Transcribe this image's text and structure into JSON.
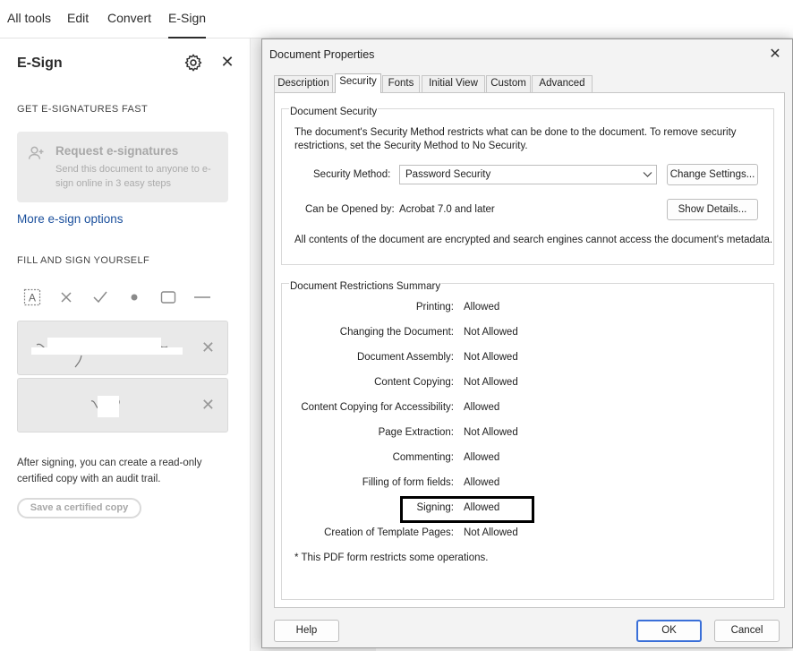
{
  "topnav": {
    "items": [
      "All tools",
      "Edit",
      "Convert",
      "E-Sign"
    ],
    "active_index": 3
  },
  "esign_panel": {
    "title": "E-Sign",
    "icons": [
      "gear-icon",
      "close-icon"
    ],
    "section_fast": "GET E-SIGNATURES FAST",
    "request_title": "Request e-signatures",
    "request_desc": "Send this document to anyone to e-sign online in 3 easy steps",
    "more_link": "More e-sign options",
    "section_self": "FILL AND SIGN YOURSELF",
    "tools": [
      "text-field-icon",
      "cross-mark-icon",
      "checkmark-icon",
      "dot-icon",
      "rectangle-icon",
      "line-icon"
    ],
    "after_text": "After signing, you can create a read-only certified copy with an audit trail.",
    "cert_button": "Save a certified copy"
  },
  "dialog": {
    "title": "Document Properties",
    "tabs": [
      "Description",
      "Security",
      "Fonts",
      "Initial View",
      "Custom",
      "Advanced"
    ],
    "active_tab": 1,
    "security_group": "Document Security",
    "security_intro": "The document's Security Method restricts what can be done to the document. To remove security restrictions, set the Security Method to No Security.",
    "method_label": "Security Method:",
    "method_value": "Password Security",
    "change_settings": "Change Settings...",
    "opened_label": "Can be Opened by:",
    "opened_value": "Acrobat 7.0 and later",
    "show_details": "Show Details...",
    "encrypt_note": "All contents of the document are encrypted and search engines cannot access the document's metadata.",
    "restrictions_group": "Document Restrictions Summary",
    "restrictions": [
      {
        "label": "Printing:",
        "value": "Allowed"
      },
      {
        "label": "Changing the Document:",
        "value": "Not Allowed"
      },
      {
        "label": "Document Assembly:",
        "value": "Not Allowed"
      },
      {
        "label": "Content Copying:",
        "value": "Not Allowed"
      },
      {
        "label": "Content Copying for Accessibility:",
        "value": "Allowed"
      },
      {
        "label": "Page Extraction:",
        "value": "Not Allowed"
      },
      {
        "label": "Commenting:",
        "value": "Allowed"
      },
      {
        "label": "Filling of form fields:",
        "value": "Allowed"
      },
      {
        "label": "Signing:",
        "value": "Allowed"
      },
      {
        "label": "Creation of Template Pages:",
        "value": "Not Allowed"
      }
    ],
    "footnote": "*   This PDF form restricts some operations.",
    "help_button": "Help",
    "ok_button": "OK",
    "cancel_button": "Cancel"
  }
}
